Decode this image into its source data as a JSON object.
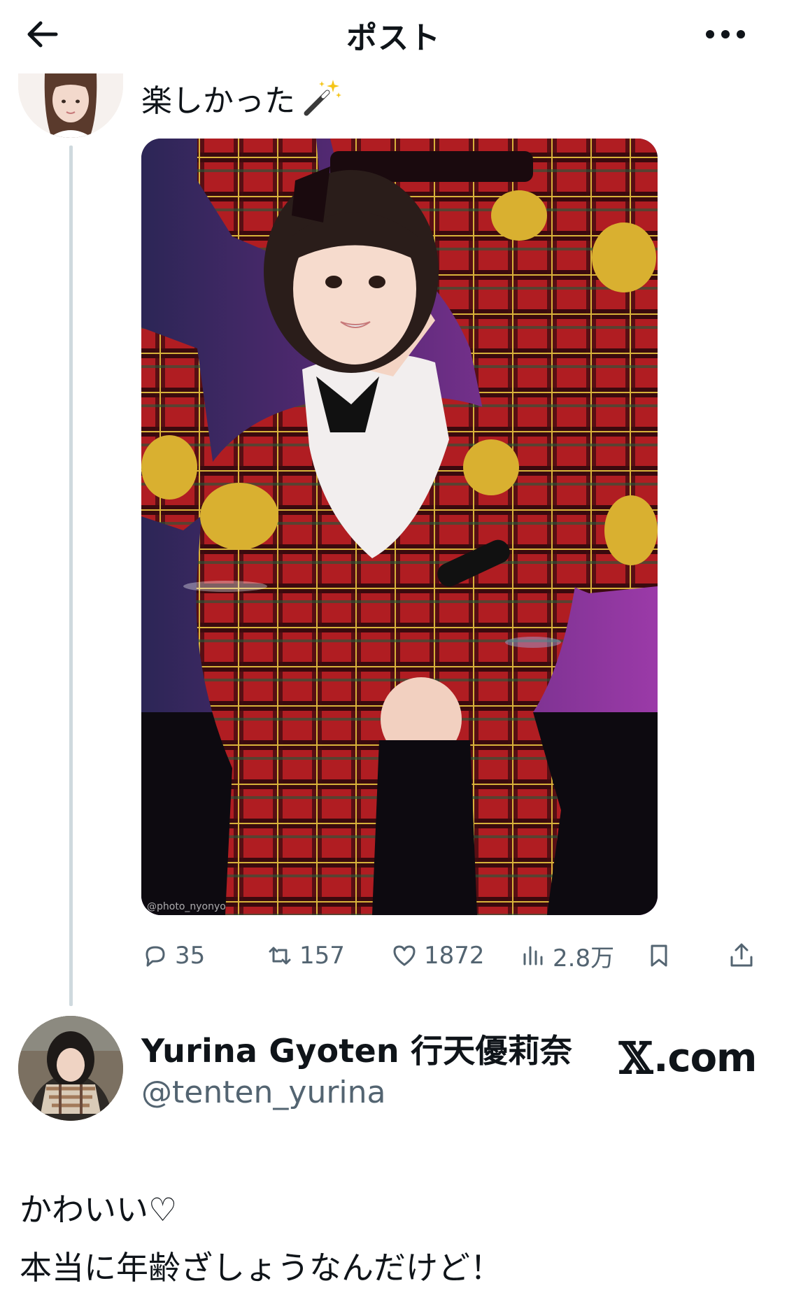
{
  "header": {
    "title": "ポスト"
  },
  "parent_post": {
    "text": "楽しかった",
    "photo_watermark": "@photo_nyonyo"
  },
  "actions": {
    "replies": "35",
    "reposts": "157",
    "likes": "1872",
    "views": "2.8万"
  },
  "quoted_account": {
    "name": "Yurina Gyoten 行天優莉奈",
    "handle": "@tenten_yurina"
  },
  "brand": {
    "mark": "𝕏",
    "text": ".com"
  },
  "post_body": {
    "line1": "かわいい♡",
    "line2": "本当に年齢ざしょうなんだけど！"
  },
  "colors": {
    "text_primary": "#0f1419",
    "text_secondary": "#536471",
    "thread_line": "#cfd9de",
    "background": "#ffffff"
  },
  "icons": {
    "back": "arrow-left-icon",
    "more": "more-horizontal-icon",
    "wand": "magic-wand-icon",
    "reply": "reply-bubble-icon",
    "repost": "repost-icon",
    "like": "heart-icon",
    "views": "views-bar-icon",
    "bookmark": "bookmark-icon",
    "share": "share-icon"
  }
}
